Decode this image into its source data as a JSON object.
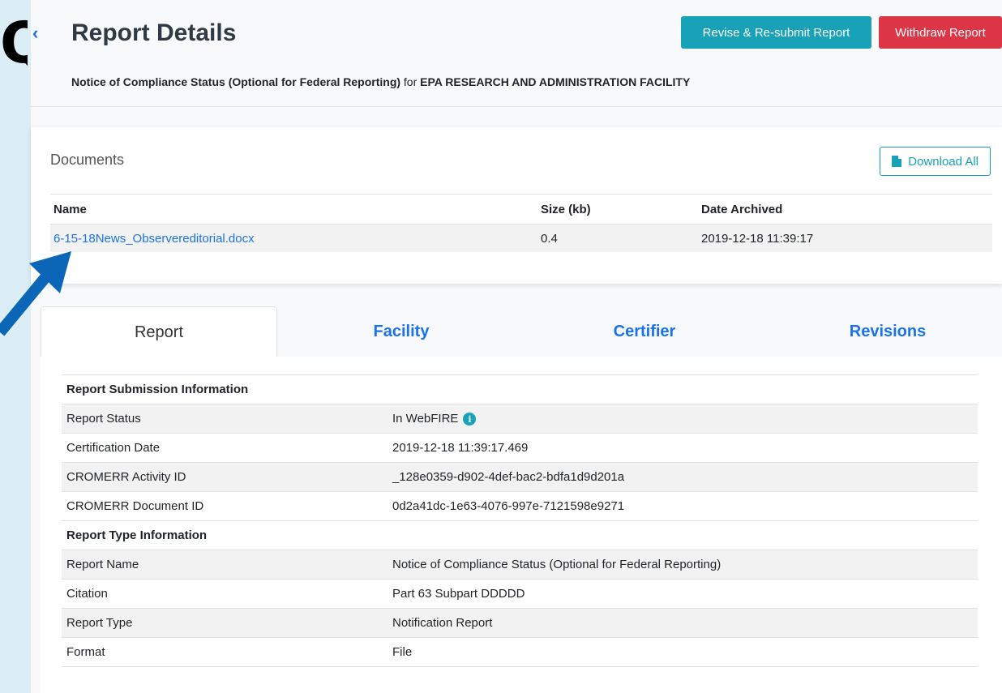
{
  "header": {
    "back_icon": "chevron-left-icon",
    "title": "Report Details",
    "revise_label": "Revise & Re-submit Report",
    "withdraw_label": "Withdraw Report",
    "subtitle_report": "Notice of Compliance Status (Optional for Federal Reporting)",
    "subtitle_for": "for",
    "subtitle_facility": "EPA RESEARCH AND ADMINISTRATION FACILITY"
  },
  "documents": {
    "title": "Documents",
    "download_all_label": "Download All",
    "download_icon": "file-icon",
    "columns": [
      "Name",
      "Size (kb)",
      "Date Archived"
    ],
    "rows": [
      {
        "name": "6-15-18News_Observereditorial.docx",
        "size": "0.4",
        "date": "2019-12-18 11:39:17"
      }
    ]
  },
  "tabs": [
    {
      "label": "Report",
      "active": true
    },
    {
      "label": "Facility",
      "active": false
    },
    {
      "label": "Certifier",
      "active": false
    },
    {
      "label": "Revisions",
      "active": false
    }
  ],
  "report": {
    "submission_heading": "Report Submission Information",
    "status_label": "Report Status",
    "status_value": "In WebFIRE",
    "status_info_icon": "info-icon",
    "cert_date_label": "Certification Date",
    "cert_date_value": "2019-12-18 11:39:17.469",
    "activity_id_label": "CROMERR Activity ID",
    "activity_id_value": "_128e0359-d902-4def-bac2-bdfa1d9d201a",
    "document_id_label": "CROMERR Document ID",
    "document_id_value": "0d2a41dc-1e63-4076-997e-7121598e9271",
    "type_heading": "Report Type Information",
    "name_label": "Report Name",
    "name_value": "Notice of Compliance Status (Optional for Federal Reporting)",
    "citation_label": "Citation",
    "citation_value": "Part 63 Subpart DDDDD",
    "type_label": "Report Type",
    "type_value": "Notification Report",
    "format_label": "Format",
    "format_value": "File"
  },
  "colors": {
    "accent": "#17a2b8",
    "danger": "#dc3545",
    "link": "#1a73e8",
    "annotation_arrow": "#0b66b8"
  }
}
